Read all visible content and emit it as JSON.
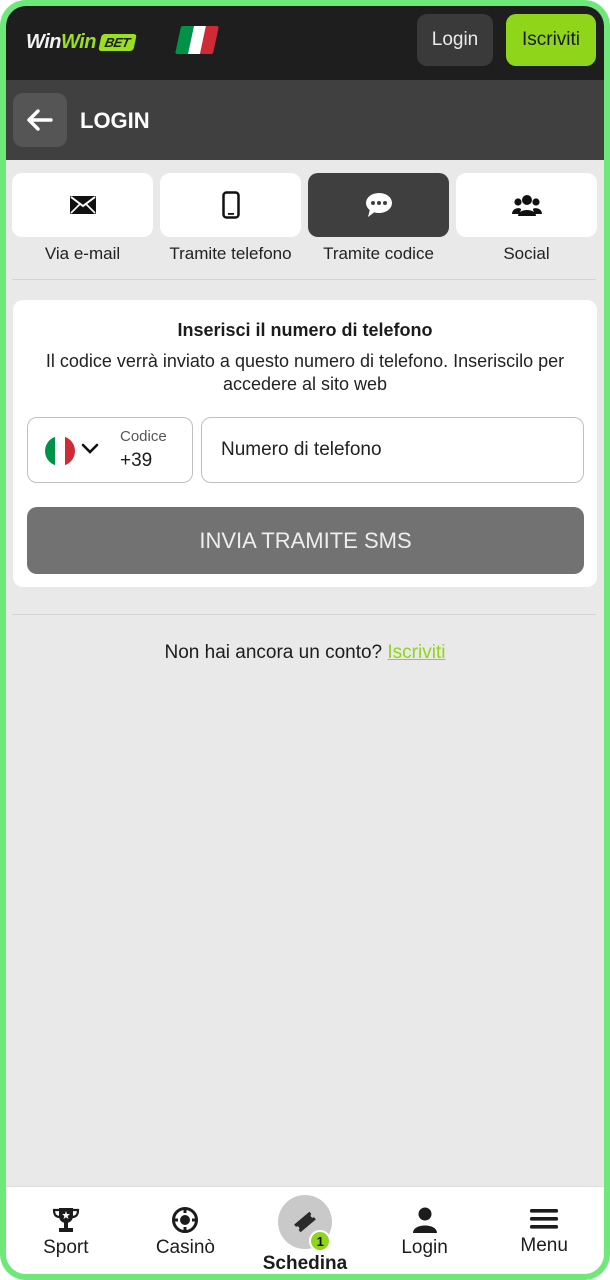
{
  "colors": {
    "accent": "#8fd61a",
    "frame": "#6fe87a",
    "topbar": "#1e1e1e",
    "subheader": "#404040",
    "active_tab": "#3f3f3f",
    "sms_button": "#727272",
    "flag_green": "#009246",
    "flag_white": "#ffffff",
    "flag_red": "#ce2b37"
  },
  "header": {
    "logo_word1": "Win",
    "logo_word2": "Win",
    "logo_bet": "BET",
    "login_label": "Login",
    "signup_label": "Iscriviti"
  },
  "page": {
    "title": "LOGIN"
  },
  "tabs": [
    {
      "label": "Via e-mail",
      "icon": "envelope-icon",
      "active": false
    },
    {
      "label": "Tramite telefono",
      "icon": "phone-icon",
      "active": false
    },
    {
      "label": "Tramite codice",
      "icon": "chat-icon",
      "active": true
    },
    {
      "label": "Social",
      "icon": "users-icon",
      "active": false
    }
  ],
  "form": {
    "title": "Inserisci il numero di telefono",
    "description": "Il codice verrà inviato a questo numero di telefono. Inseriscilo per accedere al sito web",
    "code_label": "Codice",
    "code_value": "+39",
    "phone_placeholder": "Numero di telefono",
    "submit_label": "INVIA TRAMITE SMS"
  },
  "signup_prompt": {
    "text": "Non hai ancora un conto?",
    "link": "Iscriviti"
  },
  "bottom_nav": [
    {
      "label": "Sport",
      "icon": "trophy-icon"
    },
    {
      "label": "Casinò",
      "icon": "casino-chip-icon"
    },
    {
      "label": "Schedina",
      "icon": "ticket-icon",
      "badge": "1"
    },
    {
      "label": "Login",
      "icon": "user-icon"
    },
    {
      "label": "Menu",
      "icon": "hamburger-icon"
    }
  ]
}
